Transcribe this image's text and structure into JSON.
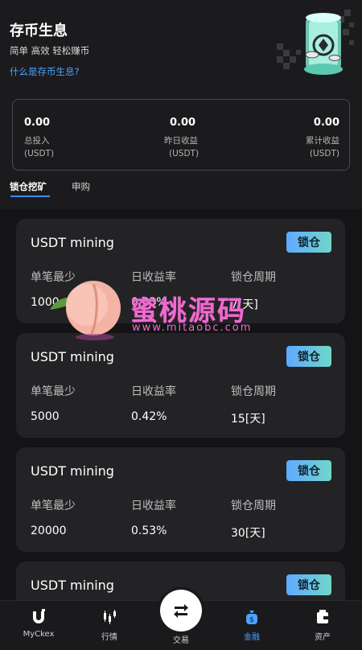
{
  "header": {
    "title": "存币生息",
    "subtitle": "简单 高效 轻松赚币",
    "help_link": "什么是存币生息?"
  },
  "summary": [
    {
      "value": "0.00",
      "label": "总投入",
      "unit": "(USDT)"
    },
    {
      "value": "0.00",
      "label": "昨日收益",
      "unit": "(USDT)"
    },
    {
      "value": "0.00",
      "label": "累计收益",
      "unit": "(USDT)"
    }
  ],
  "tabs": [
    {
      "label": "锁仓挖矿",
      "active": true
    },
    {
      "label": "申购",
      "active": false
    }
  ],
  "cards": [
    {
      "title": "USDT mining",
      "button": "锁仓",
      "min_label": "单笔最少",
      "min_value": "1000",
      "rate_label": "日收益率",
      "rate_value": "0.33%",
      "period_label": "锁仓周期",
      "period_value": "7[天]"
    },
    {
      "title": "USDT mining",
      "button": "锁仓",
      "min_label": "单笔最少",
      "min_value": "5000",
      "rate_label": "日收益率",
      "rate_value": "0.42%",
      "period_label": "锁仓周期",
      "period_value": "15[天]"
    },
    {
      "title": "USDT mining",
      "button": "锁仓",
      "min_label": "单笔最少",
      "min_value": "20000",
      "rate_label": "日收益率",
      "rate_value": "0.53%",
      "period_label": "锁仓周期",
      "period_value": "30[天]"
    },
    {
      "title": "USDT mining",
      "button": "锁仓"
    }
  ],
  "watermark": {
    "text": "蜜桃源码",
    "url": "www.mitaobc.com"
  },
  "bottom_nav": [
    {
      "label": "MyCkex",
      "icon": "magnet-logo-icon",
      "active": false
    },
    {
      "label": "行情",
      "icon": "market-icon",
      "active": false
    },
    {
      "label": "交易",
      "icon": "swap-icon",
      "active": false
    },
    {
      "label": "金融",
      "icon": "money-bag-icon",
      "active": true
    },
    {
      "label": "资产",
      "icon": "wallet-icon",
      "active": false
    }
  ],
  "colors": {
    "background": "#1b1b1d",
    "card": "#232326",
    "accent_blue": "#4aa3ff",
    "button_gradient_start": "#5fa9ff",
    "button_gradient_end": "#6fd7c8",
    "watermark": "#ef6ad0"
  }
}
